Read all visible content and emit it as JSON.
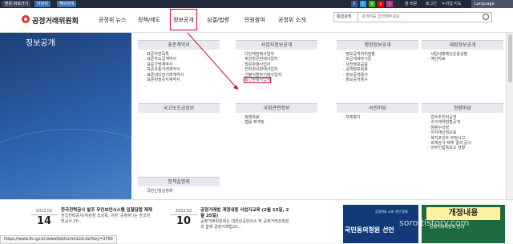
{
  "topbar": {
    "skip_label": "본문 바로가기",
    "btn2": "어린이",
    "btn3": "해외검색",
    "social": [
      "f",
      "t",
      "b",
      "y",
      "i"
    ],
    "util": [
      "정 비뮨",
      "로그인",
      "누리집 지도"
    ],
    "language": "Language"
  },
  "header": {
    "site_name": "공정거래위원회",
    "menu": [
      "공정위 뉴스",
      "정책/제도",
      "정보공개",
      "심결/법령",
      "민원참여",
      "공정위 소개"
    ],
    "search_select": "통합검색",
    "search_placeholder": "검색어를 입력해주세요."
  },
  "left": {
    "title": "정보공개"
  },
  "categories": [
    {
      "id": "c1",
      "title": "표준계약서",
      "items": [
        "표준약관목록",
        "표준하도급계약서",
        "표준가맹계약서",
        "표준유통거래계약서",
        "표준대리점거래계약서",
        "표준비밀유지계약서"
      ]
    },
    {
      "id": "c2",
      "title": "사업자정보공개",
      "items": [
        "다단계판매사업자",
        "후원방문판매사업자",
        "방문판매사업자",
        "전화권유판매사업자",
        "선불식할부거래사업자",
        "통신판매사업자"
      ],
      "highlight_index": 5
    },
    {
      "id": "c3",
      "title": "행정정보공개",
      "items": [
        "정보공개처리현황",
        "비공개세부기준",
        "사전정보공표",
        "공개정보목록",
        "정보공개용어",
        "정보공개청구"
      ]
    },
    {
      "id": "c4",
      "title": "재정정보공개",
      "items": [
        "세입세출예산운용상황",
        "예산자료"
      ]
    },
    {
      "id": "c5",
      "title": "국고보조금정보",
      "items": []
    },
    {
      "id": "c6",
      "title": "국회관련정보",
      "items": [
        "정책자료",
        "법률 제개정"
      ]
    },
    {
      "id": "c7",
      "title": "국민마당",
      "items": [
        "자체평가"
      ]
    },
    {
      "id": "c8",
      "title": "청렴마당",
      "items": [
        "업무추진비공개",
        "수의계약현황공개",
        "청렴누리방",
        "지식재산권교육",
        "복지포인트 부정사고",
        "회계감사 제재 결과 공시",
        "외부인접촉보고 현황"
      ]
    },
    {
      "id": "c9",
      "title": "정책실명제",
      "items": [
        "국민신청실명제"
      ]
    }
  ],
  "news": [
    {
      "ym": "2022.02",
      "day": "14",
      "title": "한국전력공사 발주 무인보안시스템 입찰담합 제재",
      "body": "한국전력공사(위원장 조성욱, 이하 '공정위')는 한국전력공사 20..."
    },
    {
      "ym": "2022.02",
      "day": "10",
      "title": "공정거래법 개정내용 사업자교육 (2월 15일, 2월 25일)",
      "body": "공정거래위원회는 대한상공회의소 및 공정거래조정원과 함께 공정거래법20..."
    }
  ],
  "banners": {
    "b1_small": "공정위와 소비 국민 함께",
    "b1_large": "국민동의청원 선언",
    "b2_title": "개정내용",
    "b2_sub": "공정거래위원회 안내"
  },
  "status_url": "https://www.ftc.go.kr/www/bizCommList.do?key=3765",
  "watermark": "soro.tistory.com",
  "colors": {
    "highlight": "#c8102e",
    "panel": "#2f64b0"
  }
}
